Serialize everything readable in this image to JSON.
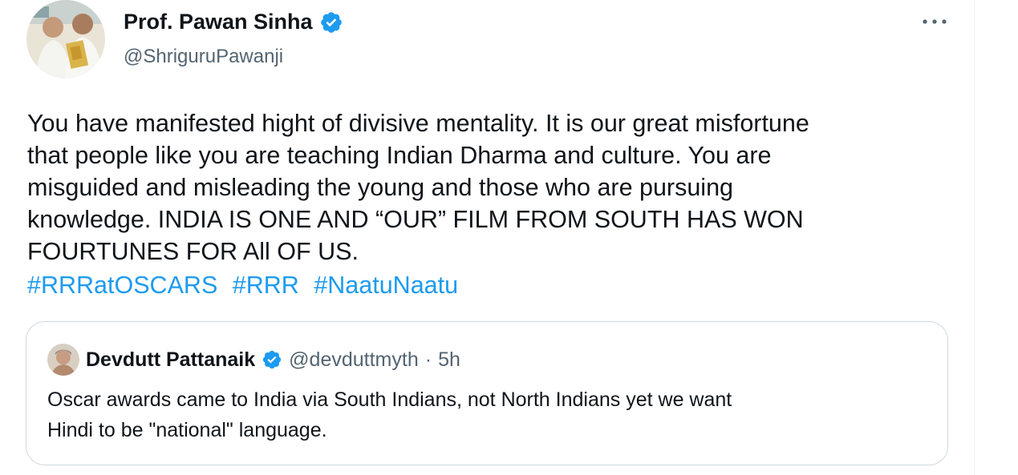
{
  "author": {
    "display_name": "Prof. Pawan Sinha",
    "handle": "@ShriguruPawanji"
  },
  "tweet": {
    "text": "You have manifested hight of divisive mentality. It is our great misfortune\nthat people like you are teaching Indian Dharma and culture. You are\nmisguided and misleading the young and those who are pursuing\nknowledge. INDIA IS ONE AND “OUR” FILM FROM SOUTH HAS WON\nFOURTUNES FOR All OF US.",
    "hashtags": [
      "#RRRatOSCARS",
      "#RRR",
      "#NaatuNaatu"
    ]
  },
  "more_icon": "ellipsis-icon",
  "quoted": {
    "display_name": "Devdutt Pattanaik",
    "handle": "@devduttmyth",
    "separator": "·",
    "time": "5h",
    "text": "Oscar awards came to India via South Indians, not North Indians yet we want\nHindi to be \"national\" language."
  },
  "colors": {
    "link": "#1d9bf0",
    "verified": "#1d9bf0",
    "secondary_text": "#536471",
    "border": "#cfd9de"
  }
}
